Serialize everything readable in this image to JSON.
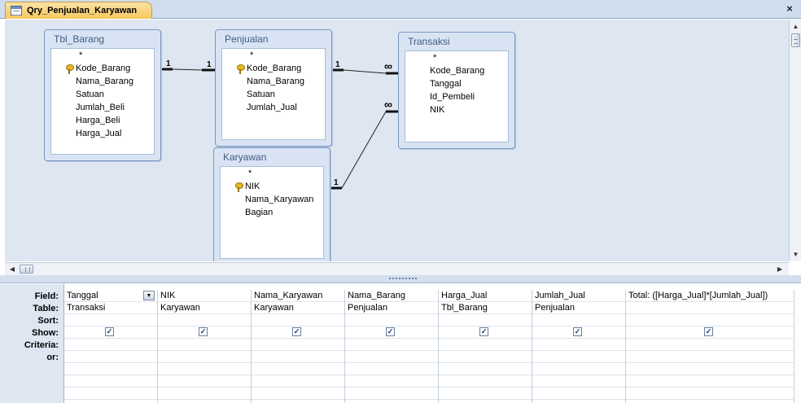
{
  "window": {
    "tab_title": "Qry_Penjualan_Karyawan",
    "close_label": "×"
  },
  "tables": [
    {
      "title": "Tbl_Barang",
      "fields": [
        {
          "name": "*",
          "key": false
        },
        {
          "name": "Kode_Barang",
          "key": true
        },
        {
          "name": "Nama_Barang",
          "key": false
        },
        {
          "name": "Satuan",
          "key": false
        },
        {
          "name": "Jumlah_Beli",
          "key": false
        },
        {
          "name": "Harga_Beli",
          "key": false
        },
        {
          "name": "Harga_Jual",
          "key": false
        }
      ]
    },
    {
      "title": "Penjualan",
      "fields": [
        {
          "name": "*",
          "key": false
        },
        {
          "name": "Kode_Barang",
          "key": true
        },
        {
          "name": "Nama_Barang",
          "key": false
        },
        {
          "name": "Satuan",
          "key": false
        },
        {
          "name": "Jumlah_Jual",
          "key": false
        }
      ]
    },
    {
      "title": "Transaksi",
      "fields": [
        {
          "name": "*",
          "key": false
        },
        {
          "name": "Kode_Barang",
          "key": false
        },
        {
          "name": "Tanggal",
          "key": false
        },
        {
          "name": "Id_Pembeli",
          "key": false
        },
        {
          "name": "NIK",
          "key": false
        }
      ]
    },
    {
      "title": "Karyawan",
      "fields": [
        {
          "name": "*",
          "key": false
        },
        {
          "name": "NIK",
          "key": true
        },
        {
          "name": "Nama_Karyawan",
          "key": false
        },
        {
          "name": "Bagian",
          "key": false
        }
      ]
    }
  ],
  "relationships": [
    {
      "from": "Tbl_Barang",
      "to": "Penjualan",
      "from_label": "1",
      "to_label": "1"
    },
    {
      "from": "Penjualan",
      "to": "Transaksi",
      "from_label": "1",
      "to_label": "∞"
    },
    {
      "from": "Karyawan",
      "to": "Transaksi",
      "from_label": "1",
      "to_label": "∞"
    }
  ],
  "grid": {
    "row_labels": [
      "Field:",
      "Table:",
      "Sort:",
      "Show:",
      "Criteria:",
      "or:"
    ],
    "columns": [
      {
        "field": "Tanggal",
        "table": "Transaksi",
        "show": true,
        "dropdown": true
      },
      {
        "field": "NIK",
        "table": "Karyawan",
        "show": true,
        "dropdown": false
      },
      {
        "field": "Nama_Karyawan",
        "table": "Karyawan",
        "show": true,
        "dropdown": false
      },
      {
        "field": "Nama_Barang",
        "table": "Penjualan",
        "show": true,
        "dropdown": false
      },
      {
        "field": "Harga_Jual",
        "table": "Tbl_Barang",
        "show": true,
        "dropdown": false
      },
      {
        "field": "Jumlah_Jual",
        "table": "Penjualan",
        "show": true,
        "dropdown": false
      },
      {
        "field": "Total: ([Harga_Jual]*[Jumlah_Jual])",
        "table": "",
        "show": true,
        "dropdown": false
      }
    ]
  },
  "icons": {
    "tab": "query-icon",
    "key": "primary-key-icon",
    "check": "✓",
    "scroll_up": "▲",
    "scroll_down": "▼",
    "scroll_left": "◀",
    "scroll_right": "▶",
    "dropdown": "▼"
  }
}
